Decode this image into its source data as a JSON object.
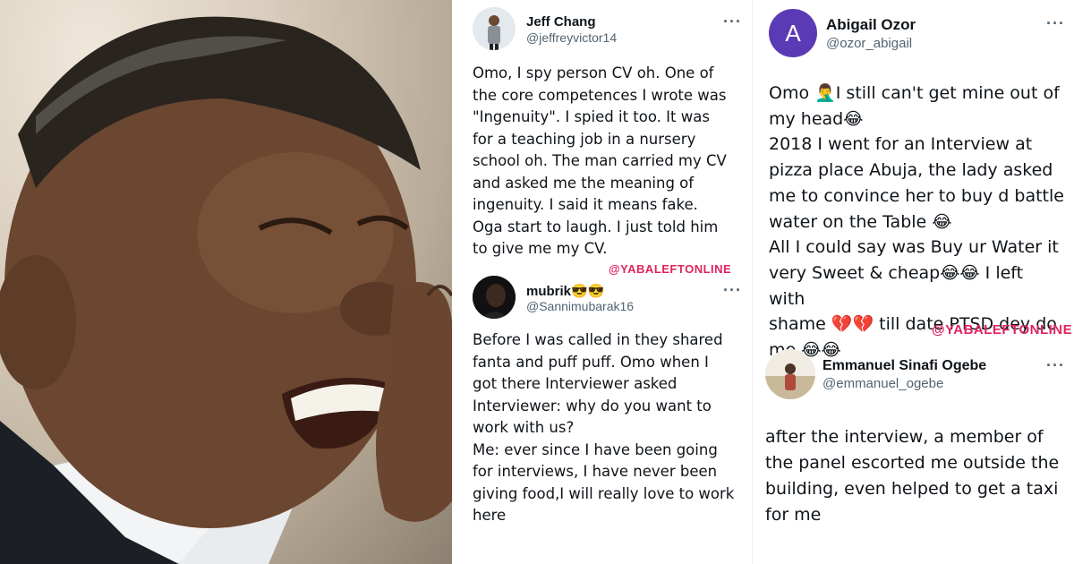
{
  "photo": {
    "description_icon": "laughing-man-photo"
  },
  "tweets": [
    {
      "name": "Jeff Chang",
      "handle": "@jeffreyvictor14",
      "more": "···",
      "text": "Omo, I spy person CV oh. One of\nthe core competences I wrote was\n\"Ingenuity\". I spied it too. It was\nfor a teaching job in a nursery\nschool oh. The man carried my CV\nand asked me the meaning of\ningenuity. I said it means fake.\nOga start to laugh. I just told him\nto give me my CV."
    },
    {
      "name": "mubrik😎😎",
      "handle": "@Sannimubarak16",
      "more": "···",
      "text": "Before I was called in they shared\nfanta and puff puff. Omo when I\ngot there Interviewer asked\nInterviewer: why do you want to\nwork with us?\nMe: ever since I have been going\nfor interviews, I have never been\ngiving food,I will really love to work\nhere"
    },
    {
      "name": "Abigail Ozor",
      "handle": "@ozor_abigail",
      "avatar_letter": "A",
      "more": "···",
      "text": "Omo 🤦‍♂️I still can't get mine out of\nmy head😂\n2018 I went for an Interview at\npizza place Abuja, the lady asked\nme to convince her to buy d battle\nwater on the Table 😂\nAll I could say was Buy ur Water it\nvery Sweet & cheap😂😂 I left with\nshame 💔💔 till date PTSD dey do\nme 😂😂"
    },
    {
      "name": "Emmanuel Sinafi Ogebe",
      "handle": "@emmanuel_ogebe",
      "more": "···",
      "text": "after the interview, a member of\nthe panel escorted me outside the\nbuilding, even helped to get a taxi\nfor me"
    }
  ],
  "watermarks": [
    "@YABALEFTONLINE",
    "@YABALEFTONLINE"
  ],
  "colors": {
    "watermark": "#e0245e",
    "abigail_avatar": "#5b3bb5",
    "handle": "#536471"
  }
}
